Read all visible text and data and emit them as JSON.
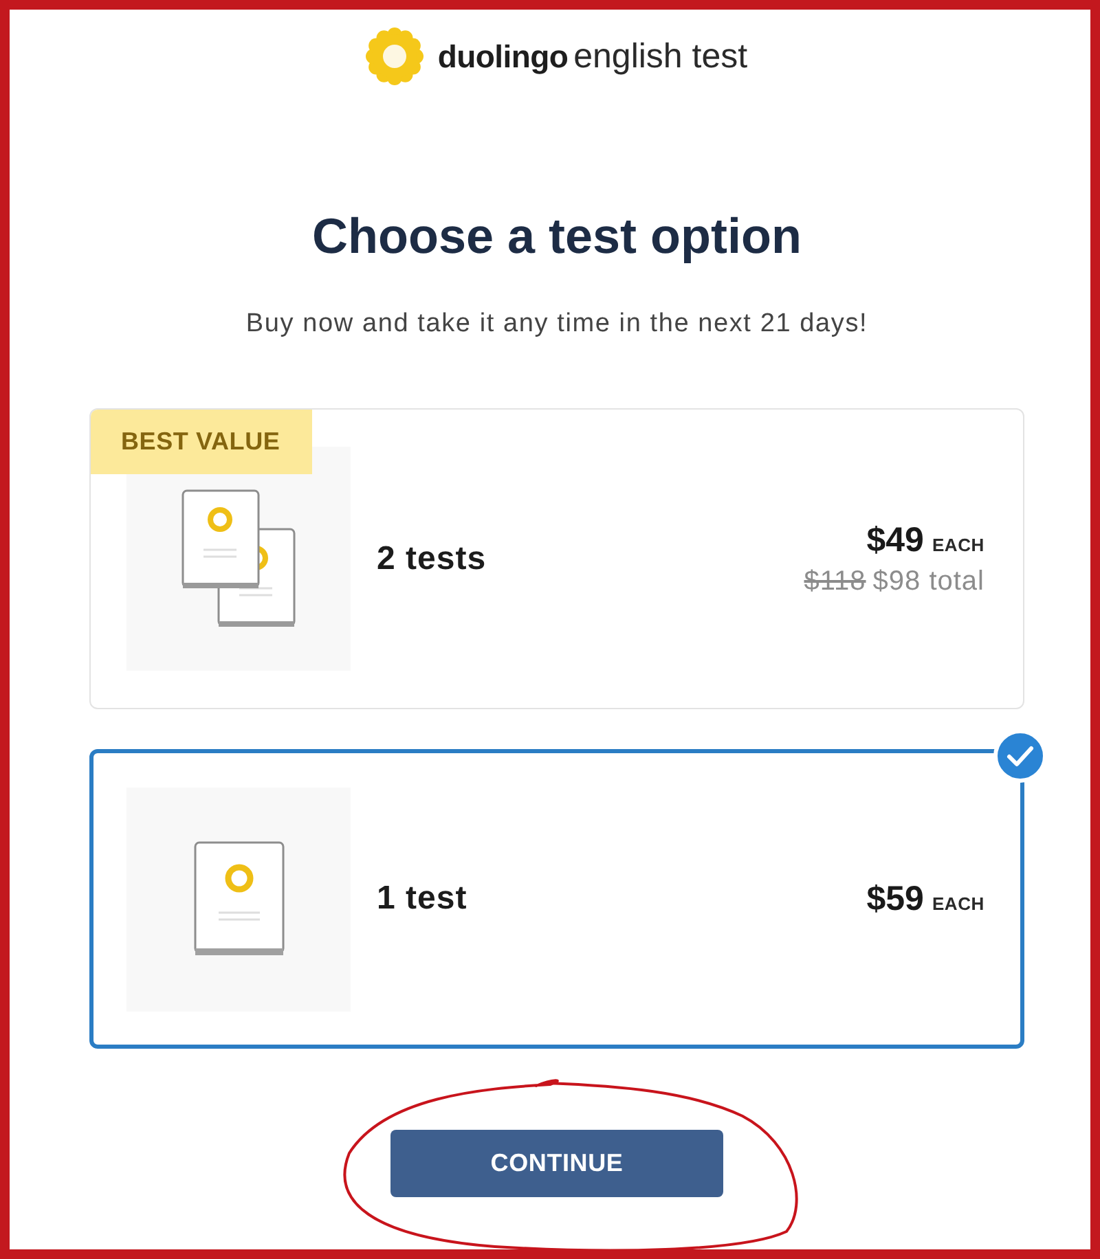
{
  "logo": {
    "brand": "duolingo",
    "product": "english test"
  },
  "heading": "Choose a test option",
  "subtitle": "Buy now and take it any time in the next 21 days!",
  "options": [
    {
      "kind": "pair",
      "badge": "BEST VALUE",
      "label": "2 tests",
      "price": "$49",
      "unit": "EACH",
      "was_total": "$118",
      "total": "$98 total",
      "selected": false
    },
    {
      "kind": "single",
      "label": "1 test",
      "price": "$59",
      "unit": "EACH",
      "selected": true
    }
  ],
  "continue_button": "CONTINUE"
}
